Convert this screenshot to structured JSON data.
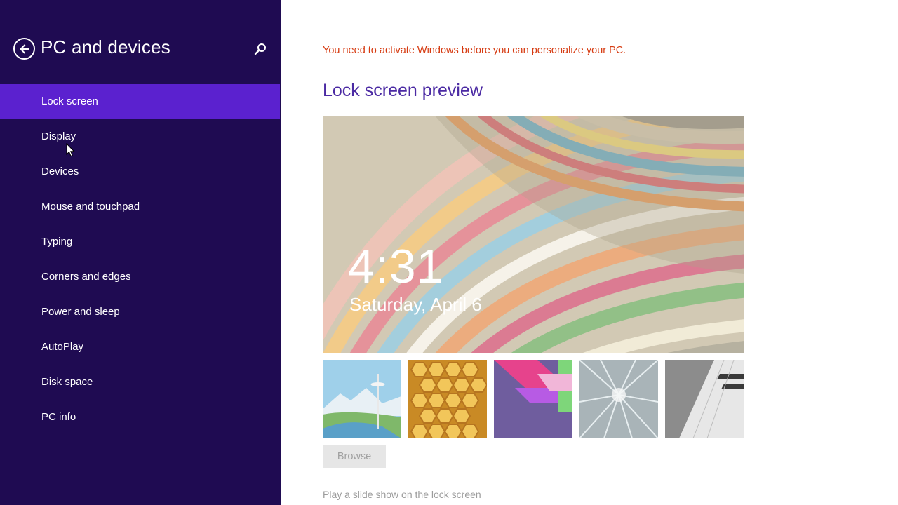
{
  "sidebar": {
    "title": "PC and devices",
    "back_icon": "back-arrow-circle-icon",
    "search_icon": "search-icon",
    "items": [
      {
        "label": "Lock screen",
        "selected": true
      },
      {
        "label": "Display",
        "selected": false
      },
      {
        "label": "Devices",
        "selected": false
      },
      {
        "label": "Mouse and touchpad",
        "selected": false
      },
      {
        "label": "Typing",
        "selected": false
      },
      {
        "label": "Corners and edges",
        "selected": false
      },
      {
        "label": "Power and sleep",
        "selected": false
      },
      {
        "label": "AutoPlay",
        "selected": false
      },
      {
        "label": "Disk space",
        "selected": false
      },
      {
        "label": "PC info",
        "selected": false
      }
    ]
  },
  "main": {
    "activation_warning": "You need to activate Windows before you can personalize your PC.",
    "section_title": "Lock screen preview",
    "preview": {
      "time": "4:31",
      "date": "Saturday, April 6"
    },
    "thumbnails": [
      {
        "name": "space-needle-thumbnail"
      },
      {
        "name": "honeycomb-thumbnail"
      },
      {
        "name": "geometric-shapes-thumbnail"
      },
      {
        "name": "speed-tunnel-thumbnail"
      },
      {
        "name": "piano-keys-thumbnail"
      }
    ],
    "browse_label": "Browse",
    "slideshow_label": "Play a slide show on the lock screen"
  },
  "colors": {
    "sidebar_bg": "#1f0b52",
    "selected_item_bg": "#5b21cf",
    "accent_title": "#4b2aa3",
    "warning_text": "#d63a10"
  }
}
